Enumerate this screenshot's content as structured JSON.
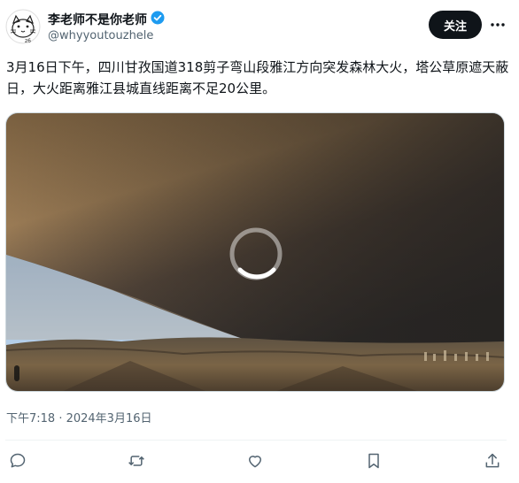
{
  "author": {
    "name": "李老师不是你老师",
    "handle": "@whyyoutouzhele",
    "verified_icon": "verified-badge-icon",
    "avatar_icon": "cat-sketch-avatar"
  },
  "follow_label": "关注",
  "tweet": {
    "text": "3月16日下午，四川甘孜国道318剪子弯山段雅江方向突发森林大火，塔公草原遮天蔽日，大火距离雅江县城直线距离不足20公里。",
    "timestamp": "下午7:18 · 2024年3月16日"
  },
  "media": {
    "type": "video",
    "state": "loading",
    "scene": "wildfire smoke cloud over grassland"
  },
  "actions": [
    {
      "name": "reply",
      "icon": "reply-icon"
    },
    {
      "name": "retweet",
      "icon": "retweet-icon"
    },
    {
      "name": "like",
      "icon": "heart-icon"
    },
    {
      "name": "bookmark",
      "icon": "bookmark-icon"
    },
    {
      "name": "share",
      "icon": "share-icon"
    }
  ],
  "colors": {
    "accent": "#1d9bf0",
    "text": "#0f1419",
    "secondary": "#536471",
    "button": "#0f1419"
  }
}
